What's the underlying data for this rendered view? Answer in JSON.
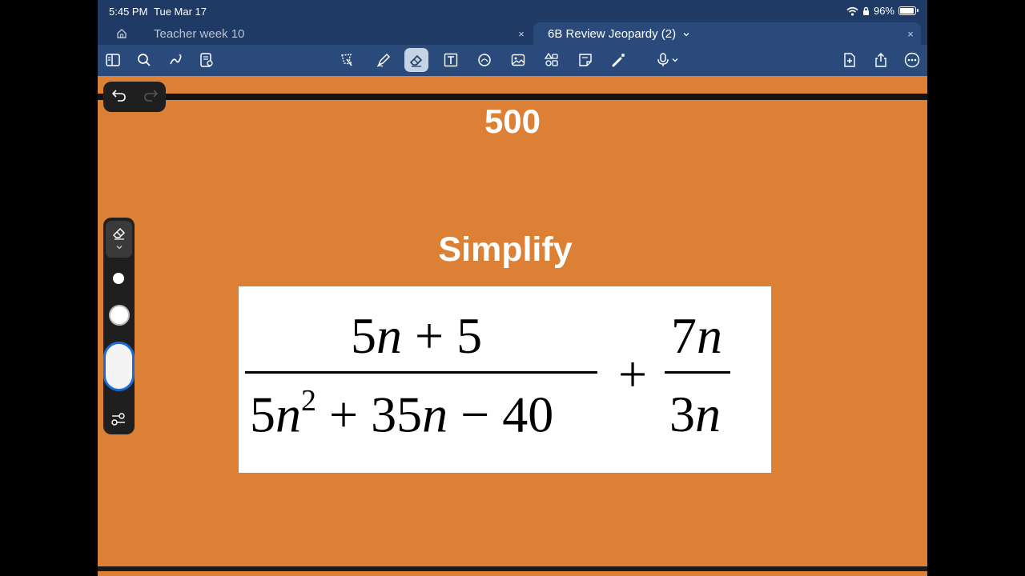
{
  "status": {
    "time": "5:45 PM",
    "date": "Tue Mar 17",
    "battery": "96%",
    "battery_level": 0.96
  },
  "tabs": [
    {
      "label": "Teacher week 10",
      "close": "×"
    },
    {
      "label": "6B Review Jeopardy (2)",
      "close": "×"
    }
  ],
  "toolbar": {
    "left": [
      "sidebar-icon",
      "search-icon",
      "ai-assist-icon",
      "page-list-icon"
    ],
    "center": [
      "lasso-icon",
      "pen-icon",
      "eraser-icon",
      "text-icon",
      "shapes-icon",
      "image-icon",
      "elements-icon",
      "sticky-note-icon",
      "laser-icon",
      "microphone-icon"
    ],
    "right": [
      "add-page-icon",
      "share-icon",
      "more-icon"
    ],
    "active_tool": "eraser"
  },
  "page": {
    "points": "500",
    "heading": "Simplify",
    "expression": {
      "frac1_num": {
        "coef": "5",
        "var": "n",
        "rest": " + 5"
      },
      "frac1_den": {
        "coef": "5",
        "var": "n",
        "exp": "2",
        "mid": " + 35",
        "var2": "n",
        "rest": " − 40"
      },
      "operator": "+",
      "frac2_num": {
        "coef": "7",
        "var": "n"
      },
      "frac2_den": {
        "coef": "3",
        "var": "n"
      }
    }
  },
  "eraser_panel": {
    "sizes": [
      "small",
      "medium",
      "large"
    ],
    "selected_size": "large"
  },
  "colors": {
    "page_background": "#dc8035",
    "chrome": "#1f3a64",
    "toolbar": "#294a7a",
    "accent": "#1d6bd6"
  }
}
